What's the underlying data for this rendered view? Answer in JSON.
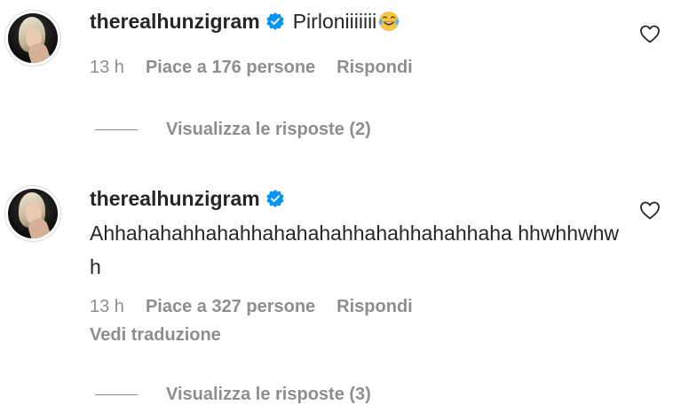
{
  "comments": [
    {
      "username": "therealhunzigram",
      "verified": true,
      "text": "Pirloniiiiiii",
      "emoji": "face-with-tears-of-joy",
      "time": "13 h",
      "likes": "Piace a 176 persone",
      "reply_label": "Rispondi",
      "view_replies": "Visualizza le risposte (2)"
    },
    {
      "username": "therealhunzigram",
      "verified": true,
      "text": "Ahhahahahhahahhahahahahhahahhahahhaha hhwhhwhwh",
      "time": "13 h",
      "likes": "Piace a 327 persone",
      "reply_label": "Rispondi",
      "translate_label": "Vedi traduzione",
      "view_replies": "Visualizza le risposte (3)"
    }
  ],
  "colors": {
    "text": "#262626",
    "muted": "#8e8e8e",
    "verified": "#0095f6",
    "background": "#ffffff"
  },
  "icons": [
    "avatar",
    "verified-badge-icon",
    "face-with-tears-of-joy-emoji",
    "heart-icon"
  ]
}
